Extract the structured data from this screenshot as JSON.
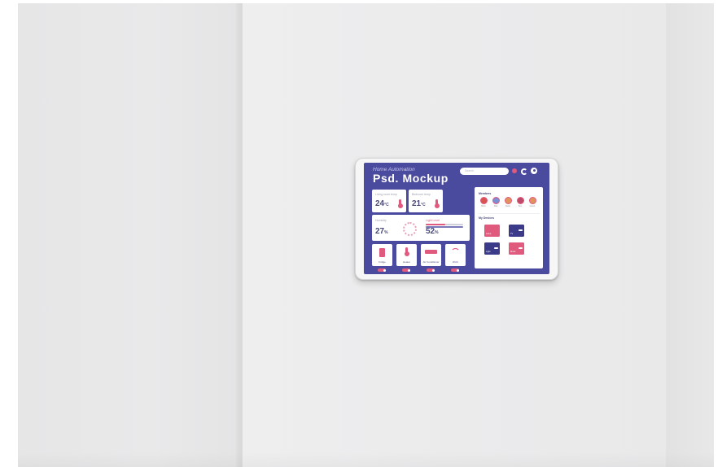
{
  "header": {
    "subtitle": "Home Automation",
    "title": "Psd. Mockup",
    "search_placeholder": "Search"
  },
  "icons": {
    "notification": "bell-icon",
    "refresh": "sync-icon",
    "profile": "user-icon"
  },
  "colors": {
    "screen_bg": "#4a4a9e",
    "accent_pink": "#e05a7e",
    "card_bg": "#ffffff",
    "wall": "#e9e9ea"
  },
  "cards": {
    "living_temp": {
      "label": "Living room temp",
      "value": "24",
      "unit": "°C"
    },
    "bed_temp": {
      "label": "Bedroom temp",
      "value": "21",
      "unit": "°C"
    },
    "second_value": {
      "label": "Humidity",
      "value": "27",
      "unit": "%"
    },
    "light_level": {
      "label": "Light Level",
      "value": "52",
      "unit": "%"
    }
  },
  "devices": [
    {
      "label": "Fridge",
      "icon": "fridge-icon",
      "on": true
    },
    {
      "label": "Heater",
      "icon": "thermometer-icon",
      "on": true
    },
    {
      "label": "Air Conditioner",
      "icon": "ac-icon",
      "on": true
    },
    {
      "label": "Wi-Fi",
      "icon": "wifi-icon",
      "on": true
    }
  ],
  "members": {
    "title": "Members",
    "items": [
      "Mom",
      "Dad",
      "Sister",
      "Son",
      "Guest"
    ]
  },
  "my_devices": {
    "title": "My Devices",
    "items": [
      {
        "label": "Lamp",
        "color": "#e05a7e"
      },
      {
        "label": "TV",
        "color": "#3b3b8a"
      },
      {
        "label": "Light",
        "color": "#3b3b8a"
      },
      {
        "label": "Music",
        "color": "#e05a7e"
      }
    ]
  }
}
